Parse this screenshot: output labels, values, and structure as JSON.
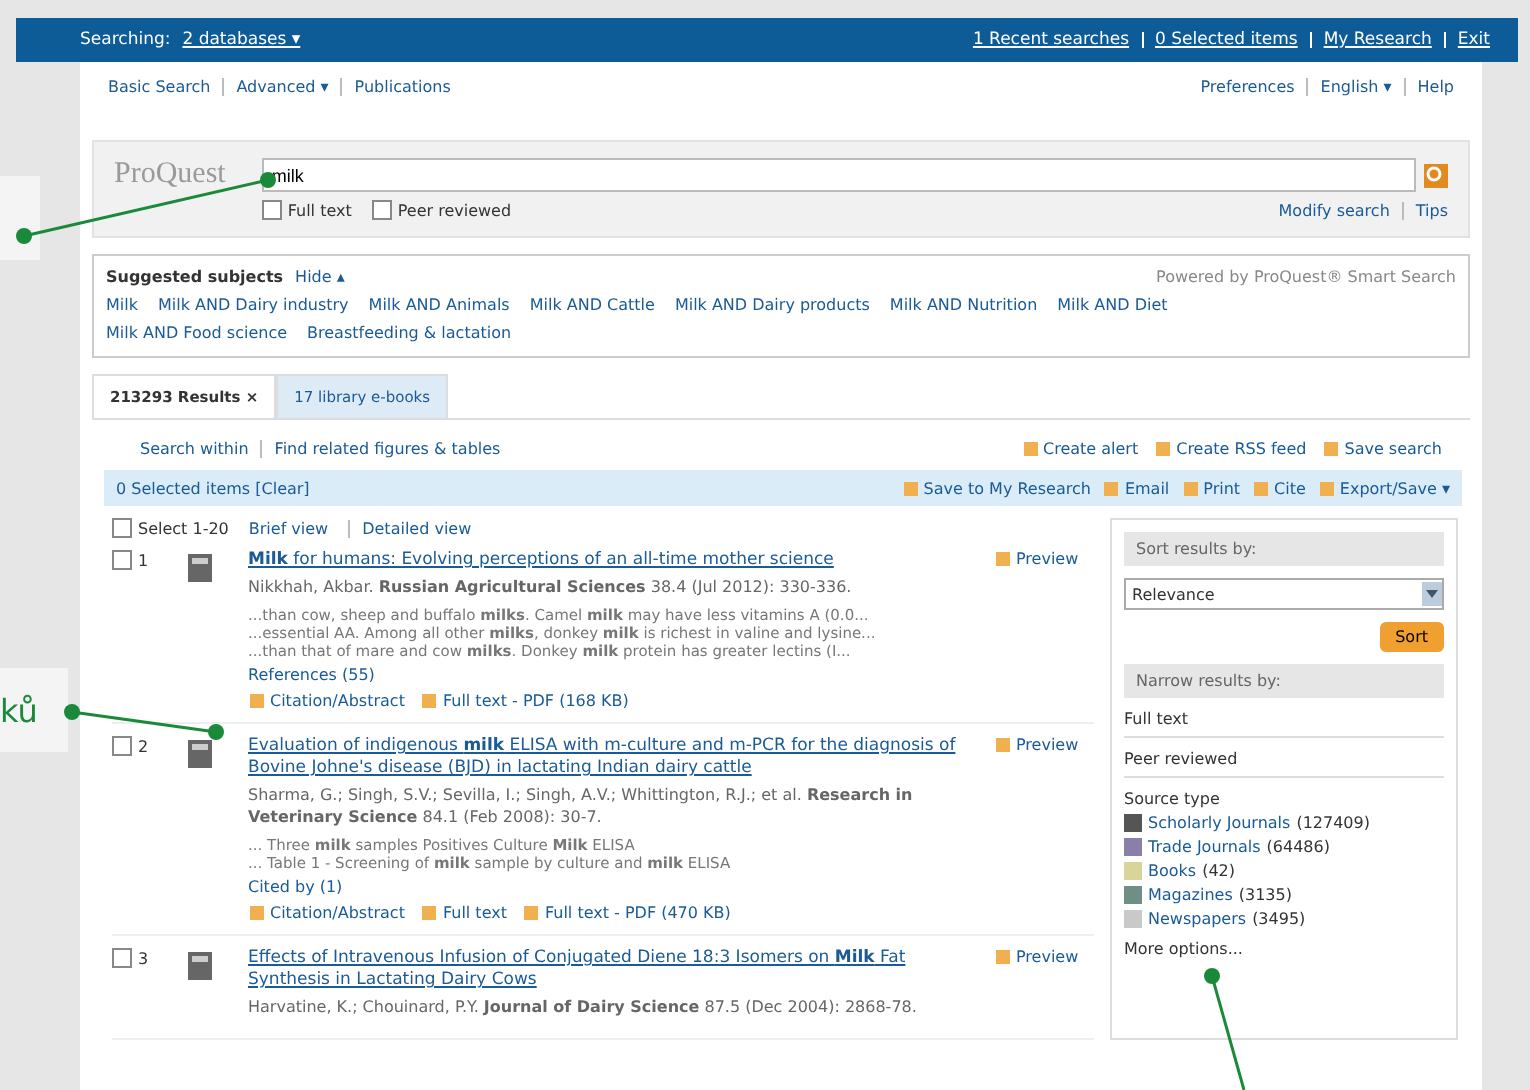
{
  "top_bar": {
    "searching_label": "Searching:",
    "databases": "2 databases ▾",
    "links": [
      "1 Recent searches",
      "0 Selected items",
      "My Research",
      "Exit"
    ]
  },
  "nav": {
    "left": [
      "Basic Search",
      "Advanced ▾",
      "Publications"
    ],
    "right": [
      "Preferences",
      "English ▾",
      "Help"
    ]
  },
  "search": {
    "logo": "ProQuest",
    "value": "milk",
    "filters": [
      {
        "label": "Full text",
        "checked": false
      },
      {
        "label": "Peer reviewed",
        "checked": false
      }
    ],
    "links": [
      "Modify search",
      "Tips"
    ]
  },
  "suggested": {
    "title": "Suggested subjects",
    "hide": "Hide ▴",
    "powered": "Powered by ProQuest® Smart Search",
    "items": [
      "Milk",
      "Milk AND Dairy industry",
      "Milk AND Animals",
      "Milk AND Cattle",
      "Milk AND Dairy products",
      "Milk AND Nutrition",
      "Milk AND Diet",
      "Milk AND Food science",
      "Breastfeeding & lactation"
    ]
  },
  "tabs": [
    {
      "label": "213293 Results ×",
      "selected": true
    },
    {
      "label": "17 library e-books",
      "selected": false
    }
  ],
  "actions": {
    "left": [
      "Search within",
      "Find related figures & tables"
    ],
    "right": [
      "Create alert",
      "Create RSS feed",
      "Save search"
    ]
  },
  "selection_bar": {
    "text": "0 Selected items [Clear]",
    "actions": [
      "Save to My Research",
      "Email",
      "Print",
      "Cite",
      "Export/Save ▾"
    ]
  },
  "list_header": {
    "select": "Select 1-20",
    "checked": false,
    "views": [
      "Brief view",
      "Detailed view"
    ]
  },
  "results": [
    {
      "number": "1",
      "title": "**Milk** for humans: Evolving perceptions of an all-time mother science",
      "meta": "Nikkhah, Akbar. **Russian Agricultural Sciences** 38.4 (Jul 2012): 330-336.",
      "snippets": [
        "...than cow, sheep and buffalo **milks**. Camel **milk** may have less vitamins A (0.0...",
        "...essential AA. Among all other **milks**, donkey **milk** is richest in valine and lysine...",
        "...than that of mare and cow **milks**. Donkey **milk** protein has greater lectins (I..."
      ],
      "extra": "References (55)",
      "links": [
        "Citation/Abstract",
        "Full text - PDF (168 KB)"
      ],
      "preview": "Preview",
      "checked": false
    },
    {
      "number": "2",
      "title": "Evaluation of indigenous **milk** ELISA with m-culture and m-PCR for the diagnosis of Bovine Johne's disease (BJD) in lactating Indian dairy cattle",
      "meta": "Sharma, G.; Singh, S.V.; Sevilla, I.; Singh, A.V.; Whittington, R.J.; et al. **Research in Veterinary Science** 84.1 (Feb 2008): 30-7.",
      "snippets": [
        "... Three **milk** samples Positives Culture **Milk** ELISA",
        "... Table 1 - Screening of **milk** sample by culture and **milk** ELISA"
      ],
      "extra": "Cited by (1)",
      "links": [
        "Citation/Abstract",
        "Full text",
        "Full text - PDF (470 KB)"
      ],
      "preview": "Preview",
      "checked": false
    },
    {
      "number": "3",
      "title": "Effects of Intravenous Infusion of Conjugated Diene 18:3 Isomers on **Milk** Fat Synthesis in Lactating Dairy Cows",
      "meta": "Harvatine, K.; Chouinard, P.Y. **Journal of Dairy Science** 87.5 (Dec 2004): 2868-78.",
      "preview": "Preview",
      "checked": false
    }
  ],
  "sidebar": {
    "sort_title": "Sort results by:",
    "sort_value": "Relevance",
    "sort_button": "Sort",
    "narrow_title": "Narrow results by:",
    "toggles": [
      "Full text",
      "Peer reviewed"
    ],
    "source_title": "Source type",
    "sources": [
      {
        "label": "Scholarly Journals",
        "count": "(127409)",
        "color": "#555555"
      },
      {
        "label": "Trade Journals",
        "count": "(64486)",
        "color": "#8a7fa8"
      },
      {
        "label": "Books",
        "count": "(42)",
        "color": "#d8d49a"
      },
      {
        "label": "Magazines",
        "count": "(3135)",
        "color": "#6f8f86"
      },
      {
        "label": "Newspapers",
        "count": "(3495)",
        "color": "#c9c9c9"
      }
    ],
    "more": "More options..."
  },
  "callouts": [
    {
      "label": "ků"
    }
  ]
}
